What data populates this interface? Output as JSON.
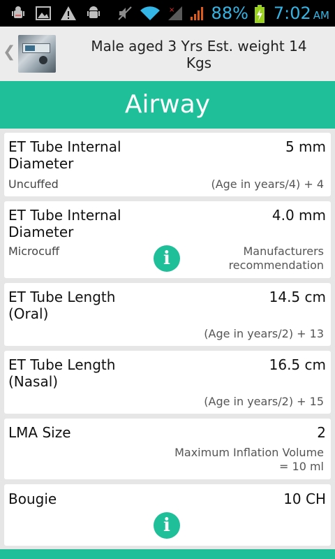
{
  "status_bar": {
    "battery_percent": "88%",
    "time": "7:02",
    "ampm": "AM",
    "icons": [
      "android-debug-icon",
      "image-icon",
      "warning-icon",
      "android-icon",
      "mute-icon",
      "wifi-icon",
      "no-signal-icon",
      "signal-icon",
      "battery-charging-icon"
    ]
  },
  "header": {
    "title": "Male aged 3 Yrs  Est. weight 14 Kgs",
    "back_glyph": "❮"
  },
  "section": {
    "title": "Airway"
  },
  "cards": [
    {
      "label": "ET Tube Internal Diameter",
      "value": "5 mm",
      "sub": "Uncuffed",
      "formula": "(Age in years/4) + 4",
      "has_info": false
    },
    {
      "label": "ET Tube Internal Diameter",
      "value": "4.0 mm",
      "sub": "Microcuff",
      "formula": "Manufacturers recommendation",
      "has_info": true
    },
    {
      "label": "ET Tube Length (Oral)",
      "value": "14.5 cm",
      "sub": "",
      "formula": "(Age in years/2) + 13",
      "has_info": false
    },
    {
      "label": "ET Tube Length (Nasal)",
      "value": "16.5 cm",
      "sub": "",
      "formula": "(Age in years/2) + 15",
      "has_info": false
    },
    {
      "label": "LMA Size",
      "value": "2",
      "sub": "",
      "formula": "Maximum Inflation Volume = 10 ml",
      "has_info": false
    },
    {
      "label": "Bougie",
      "value": "10 CH",
      "sub": "",
      "formula": "",
      "has_info": true
    }
  ],
  "info_glyph": "i",
  "colors": {
    "accent": "#1fbf9a",
    "status_text": "#33b5e5"
  }
}
